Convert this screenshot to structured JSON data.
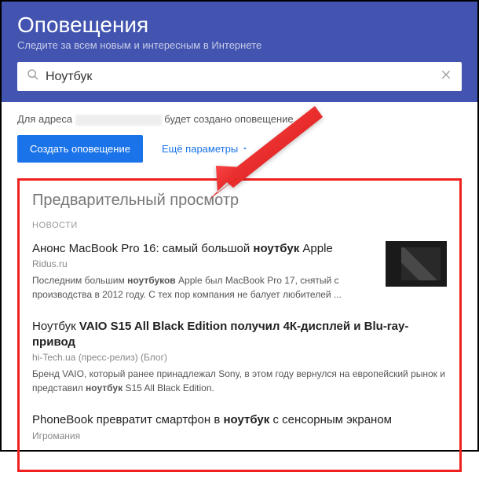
{
  "header": {
    "title": "Оповещения",
    "subtitle": "Следите за всем новым и интересным в Интернете"
  },
  "search": {
    "value": "Ноутбук",
    "placeholder": ""
  },
  "creation": {
    "prefix": "Для адреса",
    "suffix": "будет создано оповещение."
  },
  "buttons": {
    "create": "Создать оповещение",
    "more_params": "Ещё параметры"
  },
  "preview": {
    "title": "Предварительный просмотр",
    "section_label": "НОВОСТИ",
    "items": [
      {
        "title_parts": [
          "Анонс MacBook Pro 16: самый большой ",
          "ноутбук",
          " Apple"
        ],
        "source": "Ridus.ru",
        "snippet_parts": [
          "Последним большим ",
          "ноутбуков",
          " Apple был MacBook Pro 17, снятый с производства в 2012 году. С тех пор компания не балует любителей ..."
        ],
        "has_thumb": true
      },
      {
        "title_parts": [
          "Ноутбук",
          " VAIO S15 All Black Edition получил 4К-дисплей и Blu-ray-привод"
        ],
        "source": "hi-Tech.ua (пресс-релиз) (Блог)",
        "snippet_parts": [
          "Бренд VAIO, который ранее принадлежал Sony, в этом году вернулся на европейский рынок и представил ",
          "ноутбук",
          " S15 All Black Edition."
        ],
        "has_thumb": false
      },
      {
        "title_parts": [
          "PhoneBook превратит смартфон в ",
          "ноутбук",
          " с сенсорным экраном"
        ],
        "source": "Игромания",
        "snippet_parts": [],
        "has_thumb": false
      }
    ]
  },
  "icons": {
    "search": "search-icon",
    "clear": "clear-icon",
    "chevron_down": "chevron-down-icon"
  }
}
